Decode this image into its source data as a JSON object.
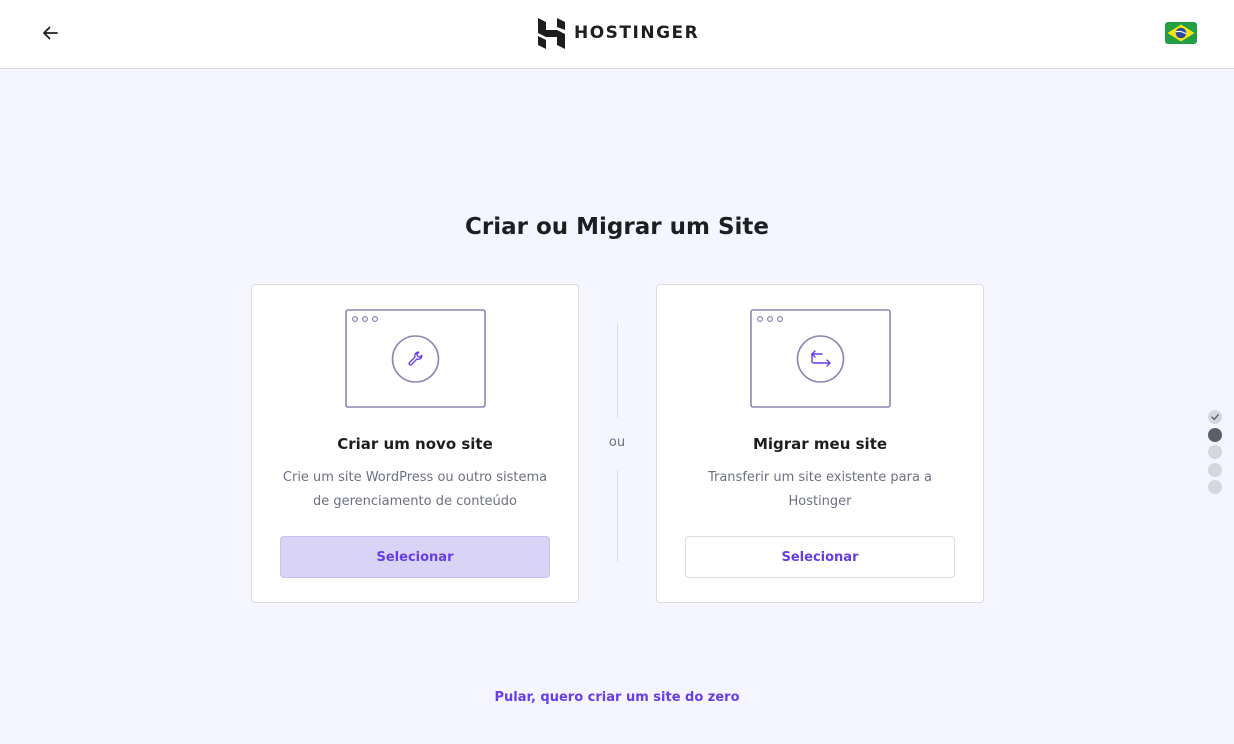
{
  "header": {
    "brand": "HOSTINGER",
    "back_icon": "arrow-left-icon",
    "language_flag": "brazil-flag-icon"
  },
  "main": {
    "title": "Criar ou Migrar um Site",
    "separator": "ou",
    "options": [
      {
        "icon": "wrench-icon",
        "title": "Criar um novo site",
        "description": "Crie um site WordPress ou outro sistema de gerenciamento de conteúdo",
        "button": "Selecionar"
      },
      {
        "icon": "transfer-arrows-icon",
        "title": "Migrar meu site",
        "description": "Transferir um site existente para a Hostinger",
        "button": "Selecionar"
      }
    ],
    "skip_link": "Pular, quero criar um site do zero"
  },
  "progress": {
    "total_steps": 5,
    "completed_steps": 1,
    "current_step": 2
  },
  "colors": {
    "accent": "#673de6",
    "background": "#f4f5ff",
    "selected_button": "#d9d3f5"
  }
}
